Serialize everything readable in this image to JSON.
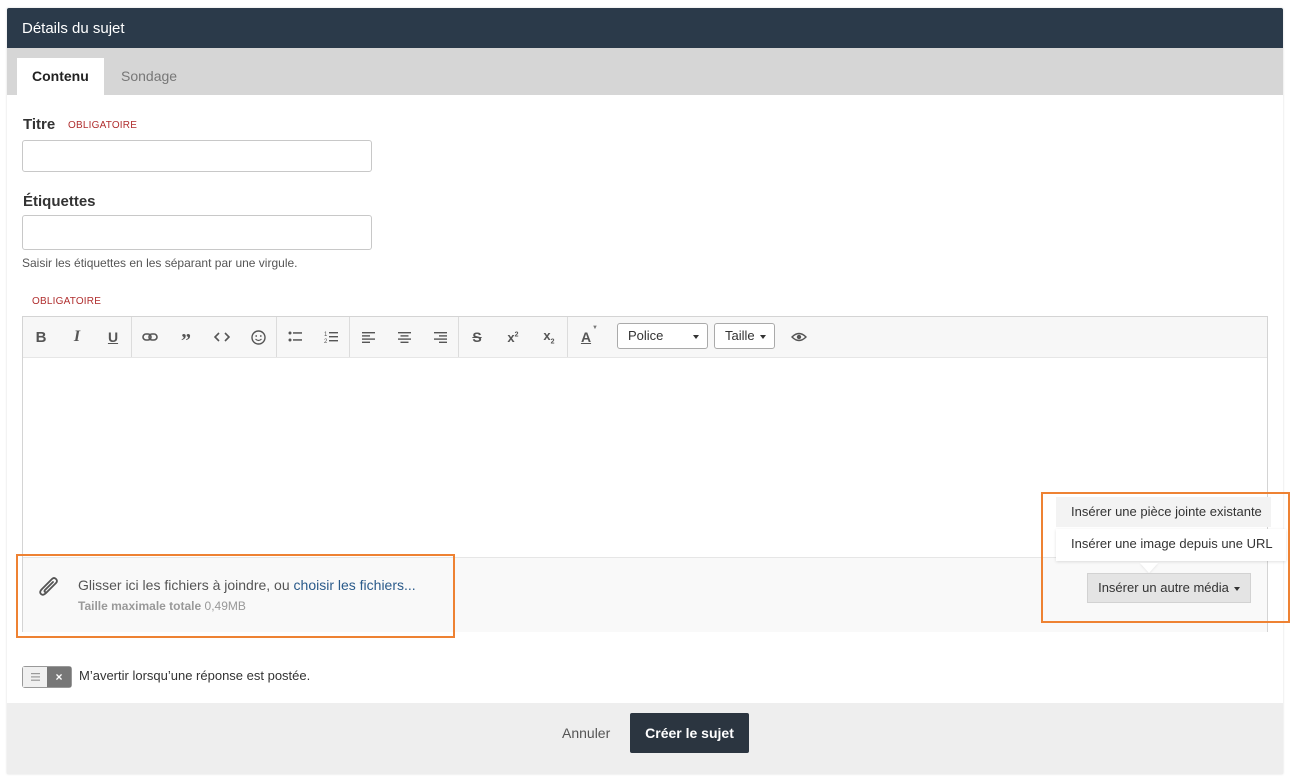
{
  "header": {
    "title": "Détails du sujet"
  },
  "tabs": [
    {
      "label": "Contenu"
    },
    {
      "label": "Sondage"
    }
  ],
  "form": {
    "title_label": "Titre",
    "required": "OBLIGATOIRE",
    "title_value": "",
    "tags_label": "Étiquettes",
    "tags_value": "",
    "tags_help": "Saisir les étiquettes en les séparant par une virgule."
  },
  "editor": {
    "required": "OBLIGATOIRE",
    "font_dropdown": "Police",
    "size_dropdown": "Taille",
    "toolbar_icons": [
      "bold-icon",
      "italic-icon",
      "underline-icon",
      "link-icon",
      "quote-icon",
      "code-icon",
      "emoji-icon",
      "bullet-list-icon",
      "numbered-list-icon",
      "align-left-icon",
      "align-center-icon",
      "align-right-icon",
      "strikethrough-icon",
      "superscript-icon",
      "subscript-icon",
      "text-color-icon",
      "preview-eye-icon"
    ]
  },
  "attachments": {
    "drop_text": "Glisser ici les fichiers à joindre, ou ",
    "choose_link": "choisir les fichiers...",
    "max_label": "Taille maximale totale",
    "max_value": "0,49MB"
  },
  "media_menu": {
    "items": [
      "Insérer une pièce jointe existante",
      "Insérer une image depuis une URL"
    ],
    "button": "Insérer un autre média"
  },
  "notify": {
    "label": "M’avertir lorsqu’une réponse est postée."
  },
  "footer": {
    "cancel": "Annuler",
    "submit": "Créer le sujet"
  },
  "colors": {
    "header_bg": "#2b3a4a",
    "highlight": "#ee8233",
    "required": "#b02e2e",
    "submit_bg": "#2b3540"
  }
}
